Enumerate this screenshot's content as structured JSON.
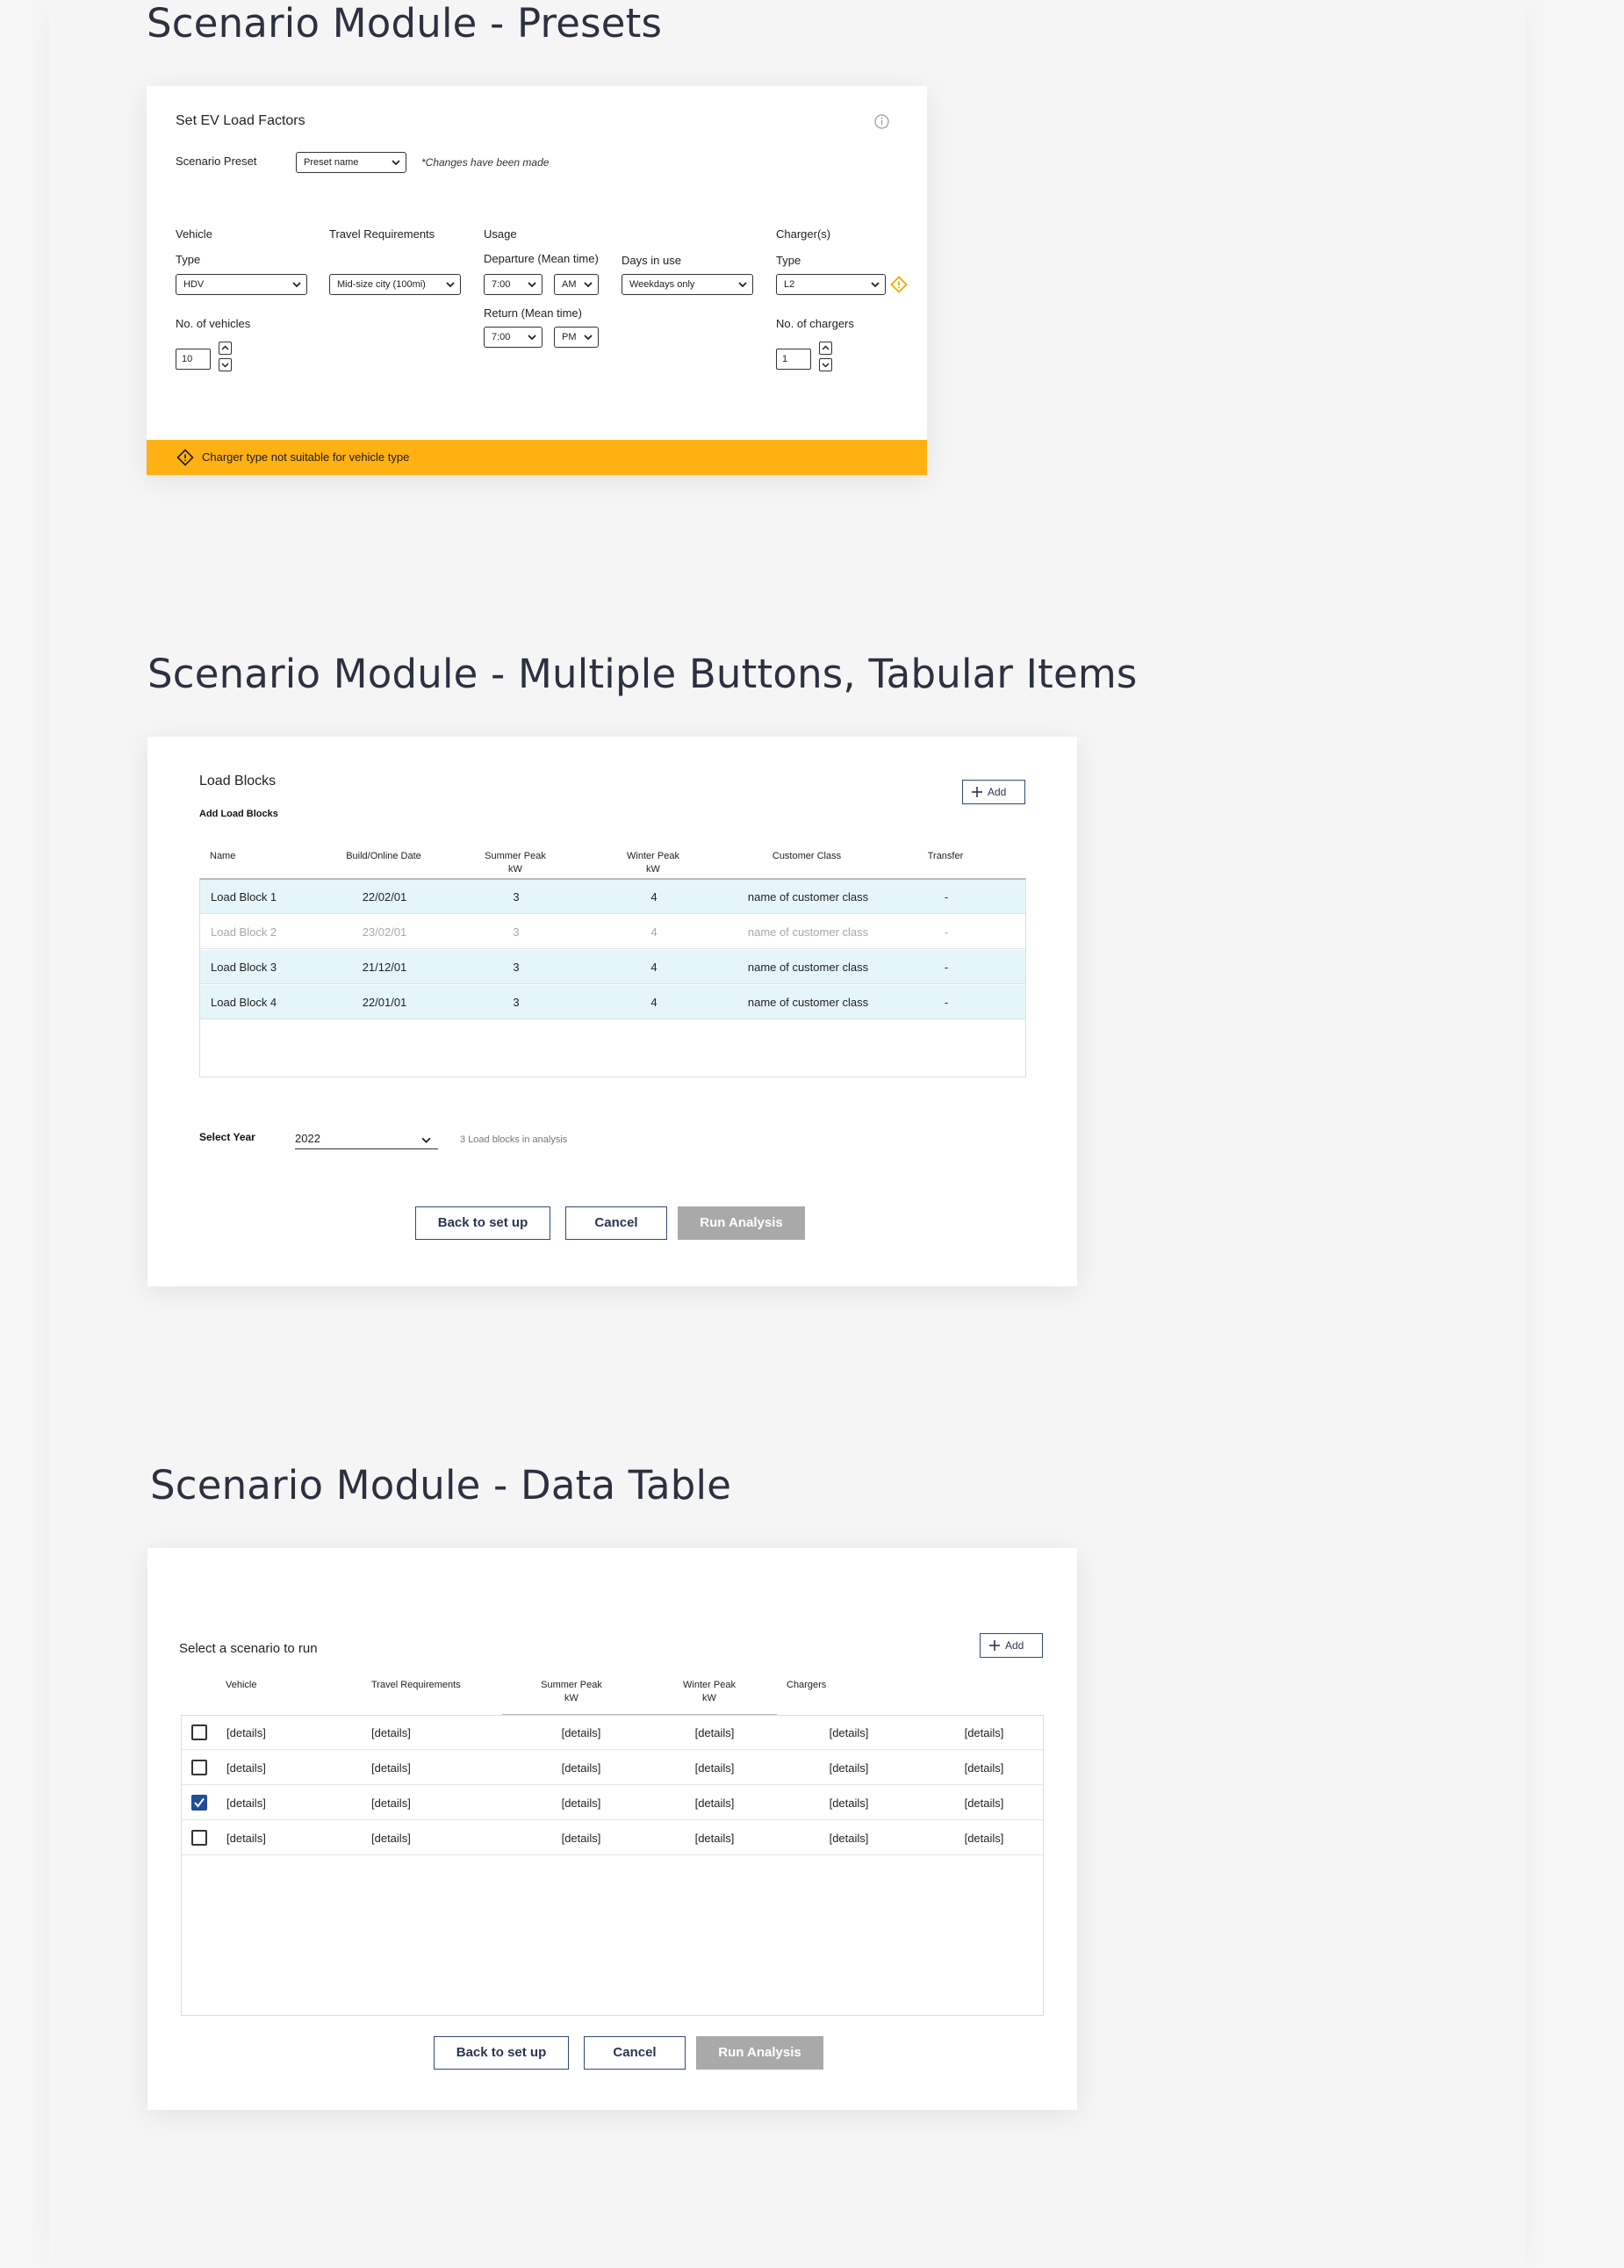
{
  "presets": {
    "section_title": "Scenario Module - Presets",
    "card_title": "Set EV Load Factors",
    "scenario_preset_label": "Scenario Preset",
    "preset_value": "Preset name",
    "changes_note": "*Changes have been made",
    "vehicle_header": "Vehicle",
    "vehicle_type_label": "Type",
    "vehicle_type_value": "HDV",
    "num_vehicles_label": "No. of vehicles",
    "num_vehicles_value": "10",
    "travel_header": "Travel Requirements",
    "travel_value": "Mid-size city (100mi)",
    "usage_header": "Usage",
    "departure_label": "Departure (Mean time)",
    "departure_time": "7:00",
    "departure_ampm": "AM",
    "return_label": "Return (Mean time)",
    "return_time": "7:00",
    "return_ampm": "PM",
    "days_label": "Days in use",
    "days_value": "Weekdays only",
    "charger_header": "Charger(s)",
    "charger_type_label": "Type",
    "charger_type_value": "L2",
    "num_chargers_label": "No. of chargers",
    "num_chargers_value": "1",
    "warning_text": "Charger type not suitable for vehicle type",
    "warning_color": "#ffb012"
  },
  "load_blocks": {
    "section_title": "Scenario Module - Multiple Buttons, Tabular Items",
    "card_title": "Load Blocks",
    "subtitle": "Add Load Blocks",
    "add_label": "Add",
    "columns": [
      "Name",
      "Build/Online Date",
      "Summer Peak\nkW",
      "Winter Peak\nkW",
      "Customer Class",
      "Transfer"
    ],
    "rows": [
      {
        "name": "Load Block 1",
        "date": "22/02/01",
        "summer": "3",
        "winter": "4",
        "customer": "name of customer class",
        "transfer": "-",
        "active": true
      },
      {
        "name": "Load Block 2",
        "date": "23/02/01",
        "summer": "3",
        "winter": "4",
        "customer": "name of customer class",
        "transfer": "-",
        "active": false
      },
      {
        "name": "Load Block 3",
        "date": "21/12/01",
        "summer": "3",
        "winter": "4",
        "customer": "name of customer class",
        "transfer": "-",
        "active": true
      },
      {
        "name": "Load Block 4",
        "date": "22/01/01",
        "summer": "3",
        "winter": "4",
        "customer": "name of customer class",
        "transfer": "-",
        "active": true
      }
    ],
    "select_year_label": "Select Year",
    "year_value": "2022",
    "analysis_note": "3 Load blocks in analysis",
    "back_label": "Back to set up",
    "cancel_label": "Cancel",
    "run_label": "Run Analysis",
    "row_active_color": "#e5f6fa"
  },
  "data_table": {
    "section_title": "Scenario Module - Data Table",
    "prompt": "Select a scenario to run",
    "add_label": "Add",
    "columns": [
      "Vehicle",
      "Travel Requirements",
      "Summer Peak\nkW",
      "Winter Peak\nkW",
      "Chargers"
    ],
    "rows": [
      {
        "checked": false,
        "cells": [
          "[details]",
          "[details]",
          "[details]",
          "[details]",
          "[details]",
          "[details]"
        ]
      },
      {
        "checked": false,
        "cells": [
          "[details]",
          "[details]",
          "[details]",
          "[details]",
          "[details]",
          "[details]"
        ]
      },
      {
        "checked": true,
        "cells": [
          "[details]",
          "[details]",
          "[details]",
          "[details]",
          "[details]",
          "[details]"
        ]
      },
      {
        "checked": false,
        "cells": [
          "[details]",
          "[details]",
          "[details]",
          "[details]",
          "[details]",
          "[details]"
        ]
      }
    ],
    "back_label": "Back to set up",
    "cancel_label": "Cancel",
    "run_label": "Run Analysis"
  }
}
